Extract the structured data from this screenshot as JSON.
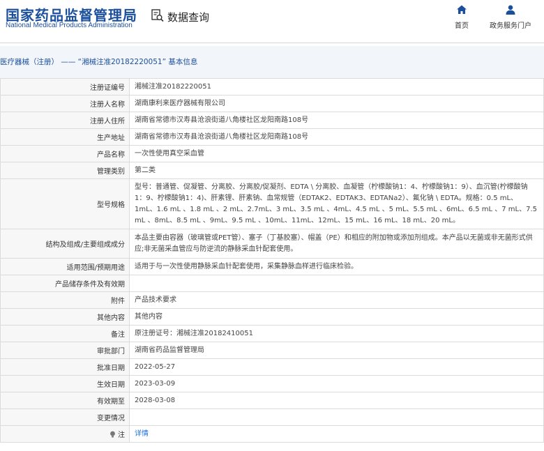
{
  "header": {
    "logo_cn": "国家药品监督管理局",
    "logo_en": "National Medical Products Administration",
    "query_title": "数据查询",
    "nav": [
      {
        "label": "首页",
        "icon": "home-icon"
      },
      {
        "label": "政务服务门户",
        "icon": "user-icon"
      }
    ]
  },
  "breadcrumb": "医疗器械（注册） —— “湘械注准20182220051” 基本信息",
  "colors": {
    "brand": "#1b4f9c",
    "link": "#1b6fd8",
    "label_bg": "#f7f7f7",
    "crumb_bg": "#f2f5f9"
  },
  "rows": [
    {
      "label": "注册证编号",
      "value": "湘械注准20182220051"
    },
    {
      "label": "注册人名称",
      "value": "湖南康利来医疗器械有限公司"
    },
    {
      "label": "注册人住所",
      "value": "湖南省常德市汉寿县沧浪街道八角楼社区龙阳南路108号"
    },
    {
      "label": "生产地址",
      "value": "湖南省常德市汉寿县沧浪街道八角楼社区龙阳南路108号"
    },
    {
      "label": "产品名称",
      "value": "一次性使用真空采血管"
    },
    {
      "label": "管理类别",
      "value": "第二类"
    },
    {
      "label": "型号规格",
      "value": "型号：普通管、促凝管、分离胶、分离胶/促凝剂、EDTA \\ 分离胶、血凝管（柠檬酸钠1：4、柠檬酸钠1：9）、血沉管(柠檬酸钠1：9、柠檬酸钠1：4)、肝素锂、肝素钠、血常规管（EDTAK2、EDTAK3、EDTANa2）、氟化钠 \\ EDTA。规格：0.5 mL、1mL、1.6 mL 、1.8 mL 、2 mL、2.7mL、3 mL、3.5 mL 、4mL、4.5 mL 、5 mL、5.5 mL 、6mL、6.5 mL 、7 mL、7.5 mL 、8mL、8.5 mL 、9mL、9.5 mL 、10mL、11mL、12mL、15 mL、16 mL、18 mL、20 mL。"
    },
    {
      "label": "结构及组成/主要组成成分",
      "value": "本品主要由容器（玻璃管或PET管）、塞子（丁基胶塞）、帽盖（PE）和相应的附加物或添加剂组成。本产品以无菌或非无菌形式供应;非无菌采血管应与防逆流的静脉采血针配套使用。"
    },
    {
      "label": "适用范围/预期用途",
      "value": "适用于与一次性使用静脉采血针配套使用，采集静脉血样进行临床检验。"
    },
    {
      "label": "产品储存条件及有效期",
      "value": ""
    },
    {
      "label": "附件",
      "value": "产品技术要求"
    },
    {
      "label": "其他内容",
      "value": "其他内容"
    },
    {
      "label": "备注",
      "value": "原注册证号：湘械注准20182410051"
    },
    {
      "label": "审批部门",
      "value": "湖南省药品监督管理局"
    },
    {
      "label": "批准日期",
      "value": "2022-05-27"
    },
    {
      "label": "生效日期",
      "value": "2023-03-09"
    },
    {
      "label": "有效期至",
      "value": "2028-03-08"
    },
    {
      "label": "变更情况",
      "value": ""
    },
    {
      "label": "注",
      "value": "详情",
      "icon": "bulb-icon"
    }
  ]
}
